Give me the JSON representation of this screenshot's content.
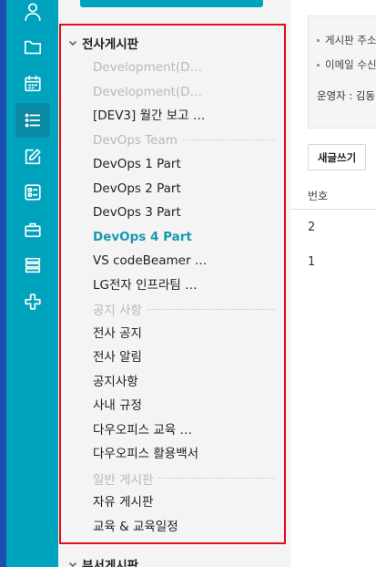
{
  "rail": {
    "icons": [
      "user-icon",
      "folder-icon",
      "calendar-icon",
      "list-icon",
      "edit-icon",
      "form-icon",
      "briefcase-icon",
      "stack-icon",
      "cross-icon"
    ],
    "active_index": 3,
    "accent": "#00a3bd",
    "edge_color": "#1c4fb0"
  },
  "tree": {
    "highlight_color": "#e30e1c",
    "active_color": "#1a97b2",
    "group_company": "전사게시판",
    "items": [
      {
        "label": "Development(D…",
        "state": "dim"
      },
      {
        "label": "Development(D…",
        "state": "dim"
      },
      {
        "label": "[DEV3] 월간 보고 …",
        "state": "normal"
      },
      {
        "label": "DevOps Team",
        "state": "divider"
      },
      {
        "label": "DevOps 1 Part",
        "state": "normal"
      },
      {
        "label": "DevOps 2 Part",
        "state": "normal"
      },
      {
        "label": "DevOps 3 Part",
        "state": "normal"
      },
      {
        "label": "DevOps 4 Part",
        "state": "active"
      },
      {
        "label": "VS codeBeamer …",
        "state": "normal"
      },
      {
        "label": "LG전자 인프라팀 …",
        "state": "normal"
      },
      {
        "label": "공지 사항",
        "state": "divider"
      },
      {
        "label": "전사 공지",
        "state": "normal"
      },
      {
        "label": "전사 알림",
        "state": "normal"
      },
      {
        "label": "공지사항",
        "state": "normal"
      },
      {
        "label": "사내 규정",
        "state": "normal"
      },
      {
        "label": "다우오피스 교육 …",
        "state": "normal"
      },
      {
        "label": "다우오피스 활용백서",
        "state": "normal"
      },
      {
        "label": "일반 게시판",
        "state": "divider"
      },
      {
        "label": "자유 게시판",
        "state": "normal"
      },
      {
        "label": "교육 & 교육일정",
        "state": "normal"
      }
    ],
    "group_department": "부서게시판"
  },
  "content": {
    "info_line1": "게시판 주소",
    "info_line2": "이메일 수신",
    "operator": "운영자 : 김동",
    "write_button": "새글쓰기",
    "column_number": "번호",
    "rows": [
      "2",
      "1"
    ]
  }
}
